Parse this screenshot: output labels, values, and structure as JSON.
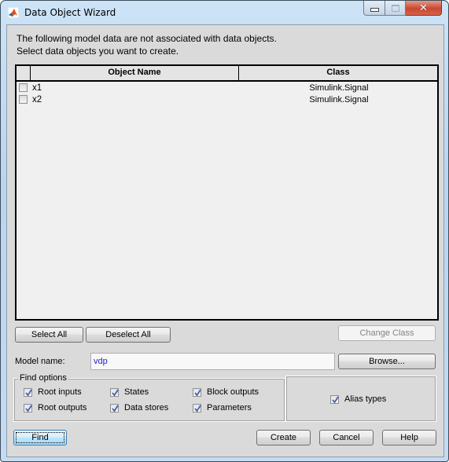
{
  "window": {
    "title": "Data Object Wizard",
    "controls": [
      "minimize",
      "maximize",
      "close"
    ]
  },
  "intro": {
    "line1": "The following model data are not associated with data objects.",
    "line2": "Select data objects you want to create."
  },
  "table": {
    "columns": [
      "",
      "Object Name",
      "Class"
    ],
    "rows": [
      {
        "checked": false,
        "name": "x1",
        "class": "Simulink.Signal"
      },
      {
        "checked": false,
        "name": "x2",
        "class": "Simulink.Signal"
      }
    ]
  },
  "buttons": {
    "select_all": "Select All",
    "deselect_all": "Deselect All",
    "change_class": "Change Class",
    "browse": "Browse...",
    "find": "Find",
    "create": "Create",
    "cancel": "Cancel",
    "help": "Help"
  },
  "model": {
    "label": "Model name:",
    "value": "vdp"
  },
  "find_options": {
    "title": "Find options",
    "items": [
      {
        "label": "Root inputs",
        "checked": true
      },
      {
        "label": "States",
        "checked": true
      },
      {
        "label": "Block outputs",
        "checked": true
      },
      {
        "label": "Root outputs",
        "checked": true
      },
      {
        "label": "Data stores",
        "checked": true
      },
      {
        "label": "Parameters",
        "checked": true
      }
    ]
  },
  "alias": {
    "label": "Alias types",
    "checked": true
  }
}
